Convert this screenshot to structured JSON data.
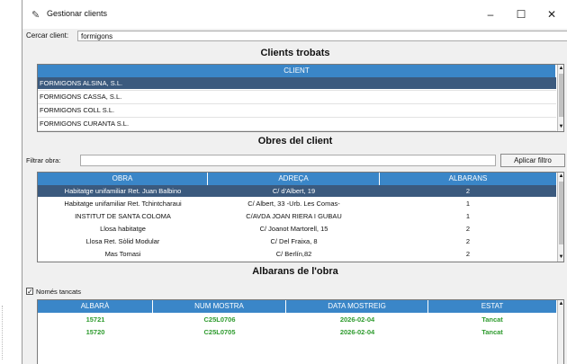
{
  "window": {
    "title": "Gestionar clients",
    "icon": "feather-icon",
    "controls": {
      "minimize": "–",
      "maximize": "☐",
      "close": "✕"
    }
  },
  "search": {
    "label": "Cercar client:",
    "value": "formigons"
  },
  "clients": {
    "title": "Clients trobats",
    "header": "CLIENT",
    "rows": [
      "FORMIGONS ALSINA, S.L.",
      "FORMIGONS CASSA, S.L.",
      "FORMIGONS COLL S.L.",
      "FORMIGONS CURANTA S.L."
    ],
    "selected_index": 0
  },
  "obres": {
    "title": "Obres del client",
    "filter_label": "Filtrar obra:",
    "filter_value": "",
    "apply_button": "Aplicar filtro",
    "headers": [
      "OBRA",
      "ADREÇA",
      "ALBARANS"
    ],
    "rows": [
      [
        "Habitatge unifamiliar Ret. Juan Balbino",
        "C/ d'Albert, 19",
        "2"
      ],
      [
        "Habitatge unifamiliar Ret. Tchintcharaui",
        "C/ Albert, 33 -Urb. Les Comas-",
        "1"
      ],
      [
        "INSTITUT DE SANTA COLOMA",
        "C/AVDA JOAN RIERA I GUBAU",
        "1"
      ],
      [
        "Llosa habitatge",
        "C/ Joanot Martorell, 15",
        "2"
      ],
      [
        "Llosa Ret. Sòlid Modular",
        "C/ Del Fraixa, 8",
        "2"
      ],
      [
        "Mas Tomasi",
        "C/ Berlín,82",
        "2"
      ]
    ],
    "selected_index": 0
  },
  "albarans": {
    "title": "Albarans de l'obra",
    "checkbox_label": "Només tancats",
    "checkbox_checked": true,
    "headers": [
      "ALBARÀ",
      "NUM MOSTRA",
      "DATA MOSTREIG",
      "ESTAT"
    ],
    "rows": [
      [
        "15721",
        "C25L0706",
        "2026-02-04",
        "Tancat"
      ],
      [
        "15720",
        "C25L0705",
        "2026-02-04",
        "Tancat"
      ]
    ]
  },
  "colors": {
    "header_blue": "#3a86c8",
    "selected_row": "#3b5a7e",
    "status_green": "#2e9b2e"
  }
}
